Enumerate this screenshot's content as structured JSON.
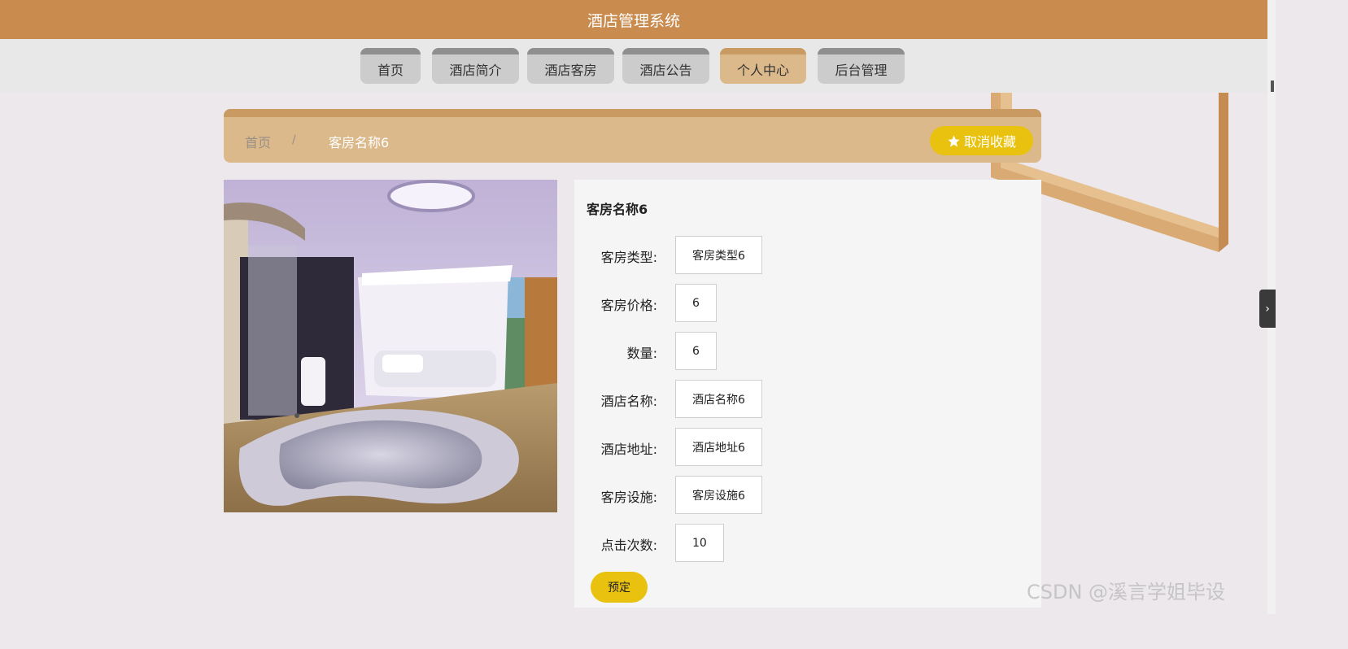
{
  "app": {
    "title": "酒店管理系统"
  },
  "nav": {
    "items": [
      {
        "label": "首页",
        "active": false
      },
      {
        "label": "酒店简介",
        "active": false
      },
      {
        "label": "酒店客房",
        "active": false
      },
      {
        "label": "酒店公告",
        "active": false
      },
      {
        "label": "个人中心",
        "active": true
      },
      {
        "label": "后台管理",
        "active": false
      }
    ]
  },
  "breadcrumb": {
    "home": "首页",
    "separator": "/",
    "current": "客房名称6"
  },
  "actions": {
    "unfavorite": "取消收藏",
    "book": "预定"
  },
  "detail": {
    "title": "客房名称6",
    "fields": [
      {
        "label": "客房类型:",
        "value": "客房类型6"
      },
      {
        "label": "客房价格:",
        "value": "6"
      },
      {
        "label": "数量:",
        "value": "6"
      },
      {
        "label": "酒店名称:",
        "value": "酒店名称6"
      },
      {
        "label": "酒店地址:",
        "value": "酒店地址6"
      },
      {
        "label": "客房设施:",
        "value": "客房设施6"
      },
      {
        "label": "点击次数:",
        "value": "10"
      }
    ]
  },
  "icons": {
    "favorite": "star-icon",
    "side_tab": "chevron-right-icon"
  },
  "colors": {
    "header": "#c98b4e",
    "accent": "#e9c20f",
    "breadcrumb": "#dbb98b",
    "active_tab": "#dcb98a"
  },
  "watermark": "CSDN @溪言学姐毕设"
}
